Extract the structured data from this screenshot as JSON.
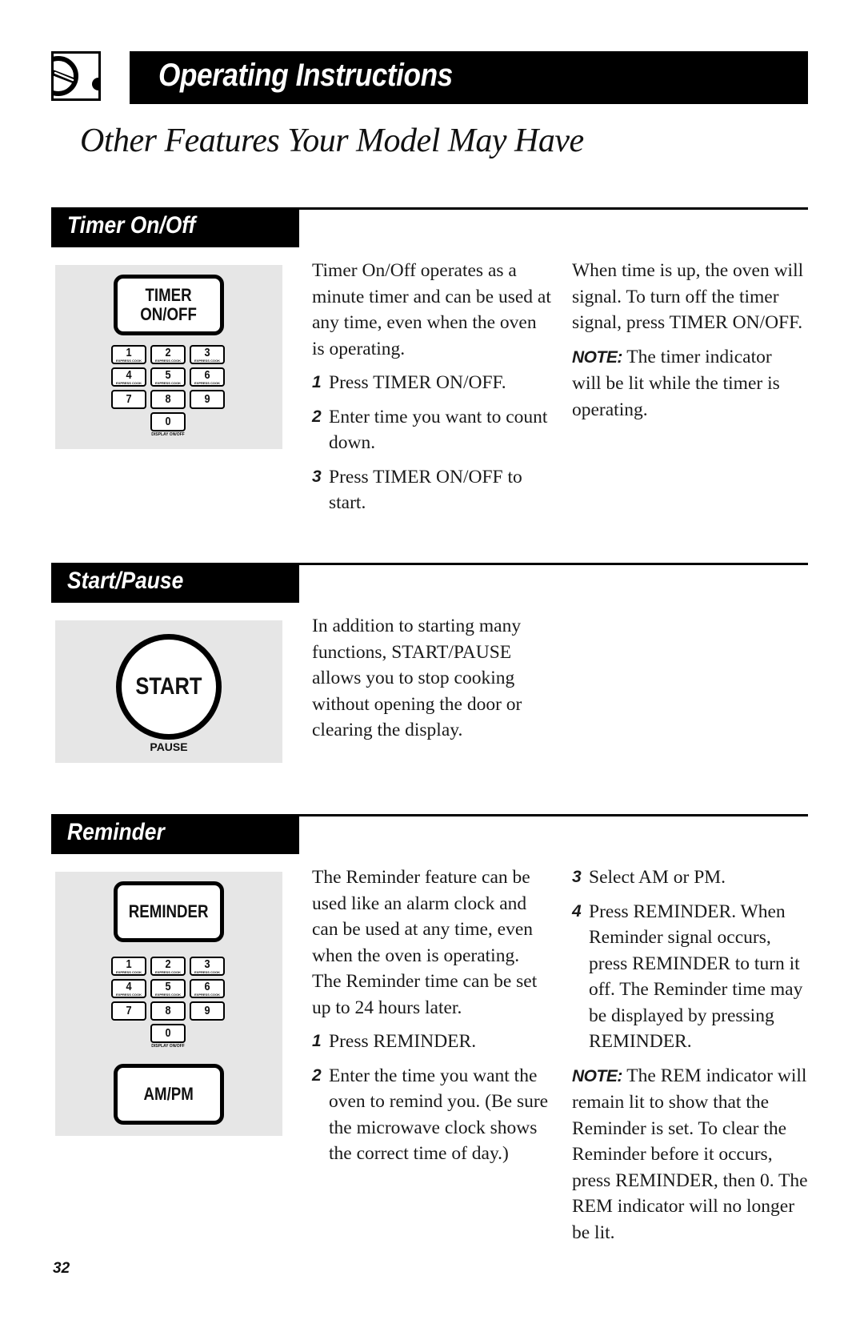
{
  "header": {
    "logo_icon": "manual-dial-icon",
    "title": "Operating Instructions"
  },
  "page_subtitle": "Other Features Your Model May Have",
  "keypad": {
    "keys": [
      {
        "num": "1",
        "sub": "EXPRESS COOK"
      },
      {
        "num": "2",
        "sub": "EXPRESS COOK"
      },
      {
        "num": "3",
        "sub": "EXPRESS COOK"
      },
      {
        "num": "4",
        "sub": "EXPRESS COOK"
      },
      {
        "num": "5",
        "sub": "EXPRESS COOK"
      },
      {
        "num": "6",
        "sub": "EXPRESS COOK"
      },
      {
        "num": "7",
        "sub": ""
      },
      {
        "num": "8",
        "sub": ""
      },
      {
        "num": "9",
        "sub": ""
      },
      {
        "num": "0",
        "sub": ""
      }
    ],
    "zero_caption": "DISPLAY ON/OFF"
  },
  "sections": {
    "timer": {
      "label": "Timer On/Off",
      "button_label": "TIMER\nON/OFF",
      "intro": "Timer On/Off operates as a minute timer and can be used at any time, even when the oven is operating.",
      "steps": [
        {
          "n": "1",
          "text": "Press TIMER ON/OFF."
        },
        {
          "n": "2",
          "text": "Enter time you want to count down."
        },
        {
          "n": "3",
          "text": "Press TIMER ON/OFF to start."
        }
      ],
      "right_para": "When time is up, the oven will signal. To turn off the timer signal, press TIMER ON/OFF.",
      "note_label": "NOTE:",
      "note_text": " The timer indicator will be lit while the timer is operating."
    },
    "start": {
      "label": "Start/Pause",
      "button_label": "START",
      "pause_label": "PAUSE",
      "text": "In addition to starting many functions, START/PAUSE allows you to stop cooking without opening the door or clearing the display."
    },
    "reminder": {
      "label": "Reminder",
      "button_label": "REMINDER",
      "ampm_label": "AM/PM",
      "intro": "The Reminder feature can be used like an alarm clock and can be used at any time, even when the oven is operating. The Reminder time can be set up to 24 hours later.",
      "steps_left": [
        {
          "n": "1",
          "text": "Press REMINDER."
        },
        {
          "n": "2",
          "text": "Enter the time you want the oven to remind you. (Be sure the microwave clock shows the correct time of day.)"
        }
      ],
      "steps_right": [
        {
          "n": "3",
          "text": "Select AM or PM."
        },
        {
          "n": "4",
          "text": "Press REMINDER. When Reminder signal occurs, press REMINDER to turn it off. The Reminder time may be displayed by pressing REMINDER."
        }
      ],
      "note_label": "NOTE:",
      "note_text": " The REM indicator will remain lit to show that the Reminder is set. To clear the Reminder before it occurs, press REMINDER, then 0. The REM indicator will no longer be lit."
    }
  },
  "page_number": "32"
}
